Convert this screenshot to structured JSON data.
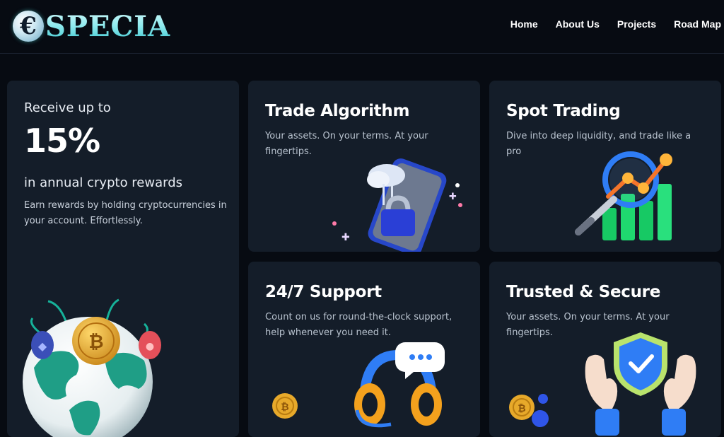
{
  "header": {
    "logo_letter": "€",
    "logo_text": "SPECIA",
    "nav": [
      "Home",
      "About Us",
      "Projects",
      "Road Map"
    ]
  },
  "rewards": {
    "pre": "Receive up to",
    "percent": "15%",
    "subtitle": "in annual crypto rewards",
    "description": "Earn rewards by holding cryptocurrencies in your account. Effortlessly."
  },
  "features": [
    {
      "title": "Trade Algorithm",
      "text": "Your assets. On your terms. At your fingertips."
    },
    {
      "title": "Spot Trading",
      "text": "Dive into deep liquidity, and trade like a pro"
    },
    {
      "title": "24/7 Support",
      "text": "Count on us for round-the-clock support, help whenever you need it."
    },
    {
      "title": "Trusted & Secure",
      "text": "Your assets. On your terms. At your fingertips."
    }
  ],
  "icons": {
    "globe": "globe-coins-icon",
    "phone": "phone-lock-icon",
    "chart": "chart-magnifier-icon",
    "support": "headphones-chat-icon",
    "secure": "hands-shield-icon"
  },
  "colors": {
    "background": "#070b12",
    "card": "#141d29",
    "logo": "#8fe3e6"
  }
}
